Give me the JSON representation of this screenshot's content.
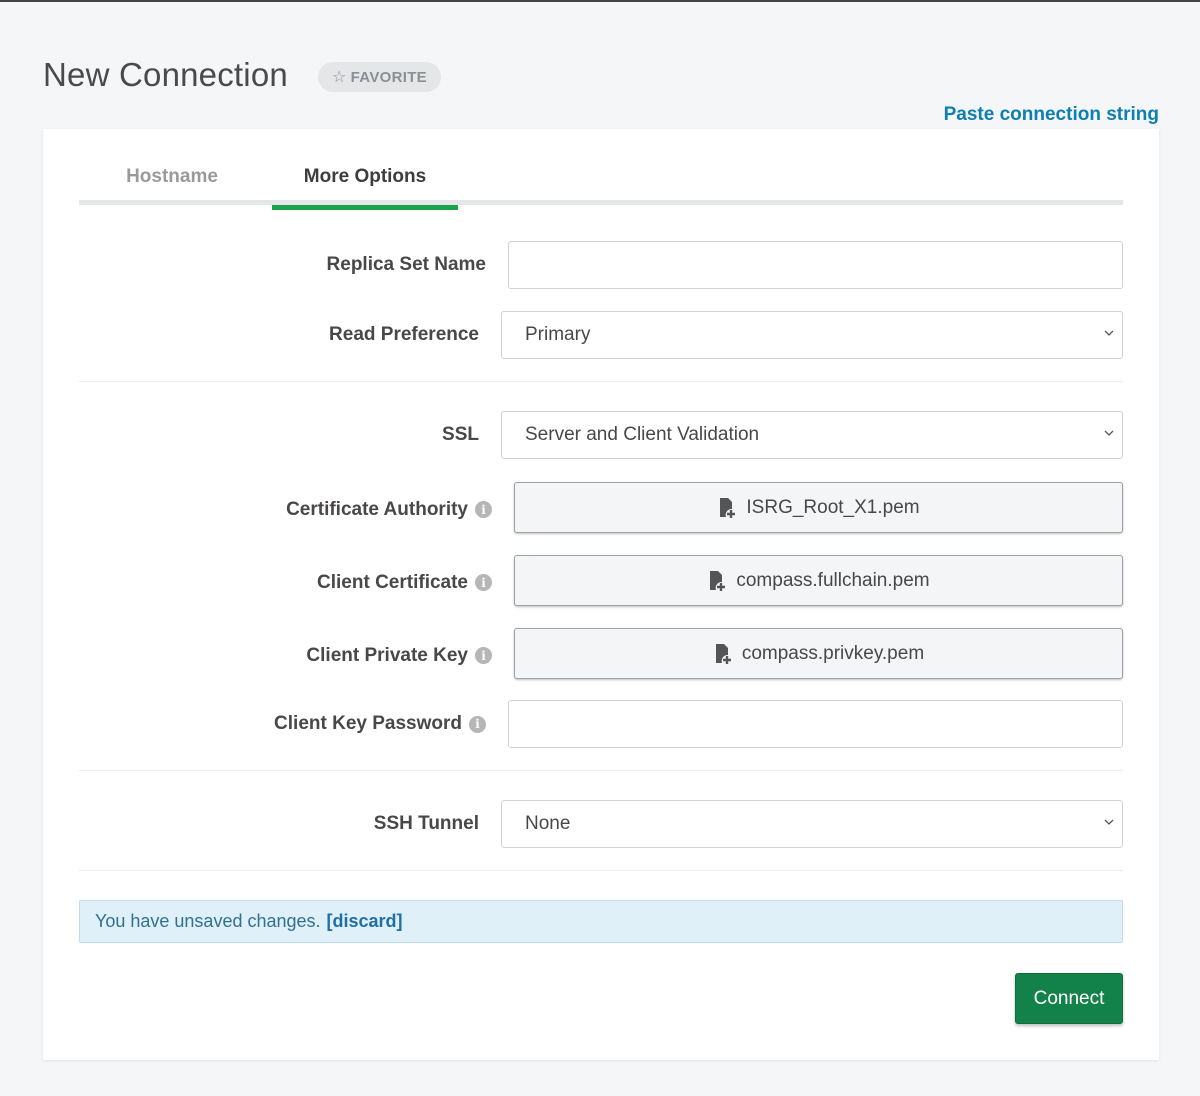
{
  "header": {
    "title": "New Connection",
    "favorite_label": "FAVORITE",
    "paste_link": "Paste connection string"
  },
  "tabs": [
    {
      "label": "Hostname",
      "active": false
    },
    {
      "label": "More Options",
      "active": true
    }
  ],
  "form": {
    "replica_set_name": {
      "label": "Replica Set Name",
      "value": ""
    },
    "read_preference": {
      "label": "Read Preference",
      "value": "Primary"
    },
    "ssl": {
      "label": "SSL",
      "value": "Server and Client Validation"
    },
    "certificate_authority": {
      "label": "Certificate Authority",
      "file": "ISRG_Root_X1.pem"
    },
    "client_certificate": {
      "label": "Client Certificate",
      "file": "compass.fullchain.pem"
    },
    "client_private_key": {
      "label": "Client Private Key",
      "file": "compass.privkey.pem"
    },
    "client_key_password": {
      "label": "Client Key Password",
      "value": ""
    },
    "ssh_tunnel": {
      "label": "SSH Tunnel",
      "value": "None"
    }
  },
  "alert": {
    "message": "You have unsaved changes.",
    "discard_label": "[discard]"
  },
  "actions": {
    "connect_label": "Connect"
  },
  "icons": {
    "info": "info-icon",
    "file": "file-add-icon",
    "chevron": "chevron-down-icon",
    "star": "star-outline-icon"
  },
  "colors": {
    "accent_green": "#13824a",
    "tab_underline": "#1aa34a",
    "link_blue": "#0d7fb1",
    "alert_bg": "#dff0f8"
  }
}
